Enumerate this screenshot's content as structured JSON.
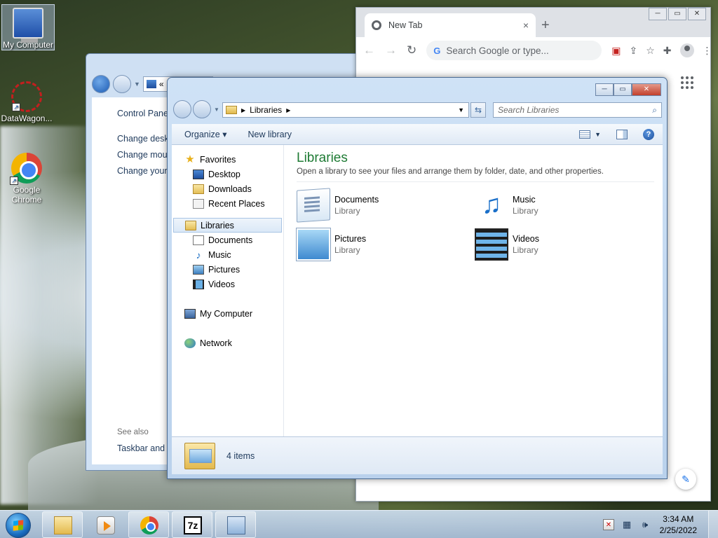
{
  "desktop": {
    "icons": [
      {
        "label": "My Computer",
        "icon": "computer-icon"
      },
      {
        "label": "DataWagon...",
        "icon": "datawagon-icon"
      },
      {
        "label": "Google Chrome",
        "icon": "chrome-icon"
      }
    ]
  },
  "control_panel": {
    "breadcrumb_prefix": "«",
    "header": "Control Panel H",
    "links": [
      "Change deskto",
      "Change mouse",
      "Change your a"
    ],
    "see_also": "See also",
    "see_also_link": "Taskbar and St"
  },
  "chrome": {
    "tab_title": "New Tab",
    "tab_close": "×",
    "new_tab": "+",
    "omnibox_placeholder": "Search Google or type...",
    "window_buttons": [
      "─",
      "▭",
      "✕"
    ]
  },
  "explorer": {
    "address_path": "Libraries",
    "search_placeholder": "Search Libraries",
    "commands": {
      "organize": "Organize ▾",
      "new_library": "New library"
    },
    "window_buttons": {
      "min": "─",
      "max": "▭",
      "close": "✕"
    },
    "nav": {
      "favorites": "Favorites",
      "favorites_items": [
        "Desktop",
        "Downloads",
        "Recent Places"
      ],
      "libraries": "Libraries",
      "libraries_items": [
        "Documents",
        "Music",
        "Pictures",
        "Videos"
      ],
      "computer": "My Computer",
      "network": "Network"
    },
    "content": {
      "title": "Libraries",
      "subtitle": "Open a library to see your files and arrange them by folder, date, and other properties.",
      "items": [
        {
          "name": "Documents",
          "type": "Library",
          "icon": "documents-library-icon"
        },
        {
          "name": "Music",
          "type": "Library",
          "icon": "music-library-icon"
        },
        {
          "name": "Pictures",
          "type": "Library",
          "icon": "pictures-library-icon"
        },
        {
          "name": "Videos",
          "type": "Library",
          "icon": "videos-library-icon"
        }
      ]
    },
    "details": {
      "count": "4 items"
    }
  },
  "taskbar": {
    "time": "3:34 AM",
    "date": "2/25/2022",
    "seven_zip_label": "7z"
  }
}
